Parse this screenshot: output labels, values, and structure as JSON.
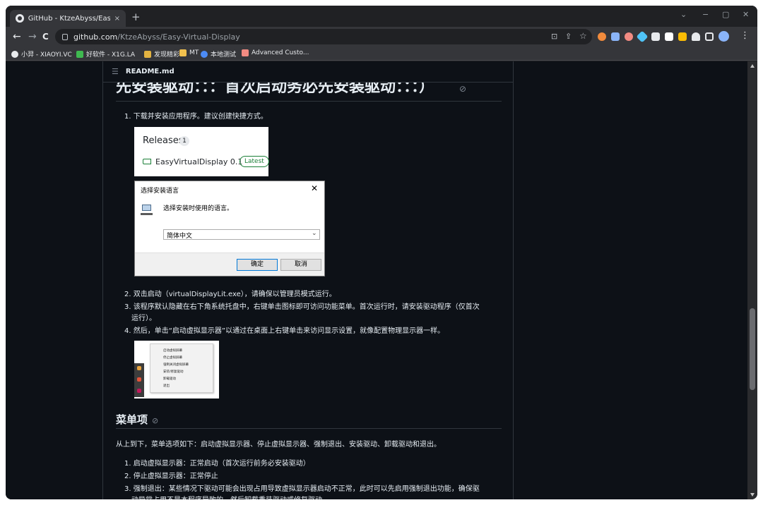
{
  "window": {
    "tab_title": "GitHub - KtzeAbyss/Easy-Virtu",
    "tab_close": "×",
    "new_tab": "+",
    "controls": [
      "⌄",
      "−",
      "▢",
      "✕"
    ]
  },
  "toolbar": {
    "back": "←",
    "forward": "→",
    "reload": "C",
    "url_host": "github.com",
    "url_path": "/KtzeAbyss/Easy-Virtual-Display",
    "install_icon": "⊡",
    "share_icon": "⇪",
    "bookmark_star": "☆",
    "menu": "⋮"
  },
  "bookmarks": [
    {
      "label": "小羿 - XIAOYI.VC",
      "color": "#e8eaed"
    },
    {
      "label": "好软件 - X1G.LA",
      "color": "#3fb950"
    },
    {
      "label": "发现精彩",
      "color": "#e3b341"
    },
    {
      "label": "MT",
      "color": "#f2c14e"
    },
    {
      "label": "本地测试",
      "color": "#4c8bf5"
    },
    {
      "label": "Advanced Custo...",
      "color": "#f28b82"
    }
  ],
  "readme": {
    "list_icon": "☰",
    "file_name": "README.md",
    "heading_partial": "先安装驱动：：：首次启动务必先安装驱动：：：）",
    "link_icon": "⊘",
    "step1": "1. 下载并安装应用程序。建议创建快捷方式。",
    "releases": {
      "title": "Releases",
      "count": "1",
      "name": "EasyVirtualDisplay 0.1",
      "latest": "Latest"
    },
    "dialog": {
      "title": "选择安装语言",
      "close": "✕",
      "message": "选择安装时使用的语言。",
      "language": "简体中文",
      "chevron": "⌄",
      "ok": "确定",
      "cancel": "取消"
    },
    "step2": "2. 双击启动（virtualDisplayLit.exe），请确保以管理员模式运行。",
    "step3a": "3. 该程序默认隐藏在右下角系统托盘中，右键单击图标即可访问功能菜单。首次运行时，请安装驱动程序（仅首次",
    "step3b": "运行）。",
    "step4": "4. 然后，单击“启动虚拟显示器”以通过在桌面上右键单击来访问显示设置，就像配置物理显示器一样。",
    "context_menu": [
      "启动虚拟屏幕",
      "停止虚拟屏幕",
      "强制关闭虚拟屏幕",
      "安装/修复驱动",
      "卸载驱动",
      "退出"
    ],
    "menu_heading": "菜单项",
    "menu_intro": "从上到下，菜单选项如下：启动虚拟显示器、停止虚拟显示器、强制退出、安装驱动、卸载驱动和退出。",
    "item1": "1. 启动虚拟显示器：正常启动（首次运行前务必安装驱动）",
    "item2": "2. 停止虚拟显示器：正常停止",
    "item3a": "3. 强制退出：某些情况下驱动可能会出现占用导致虚拟显示器启动不正常，此时可以先启用强制退出功能，确保驱",
    "item3b": "动异常占用不是本程序导致的，然后卸载重装驱动或修复驱动"
  }
}
